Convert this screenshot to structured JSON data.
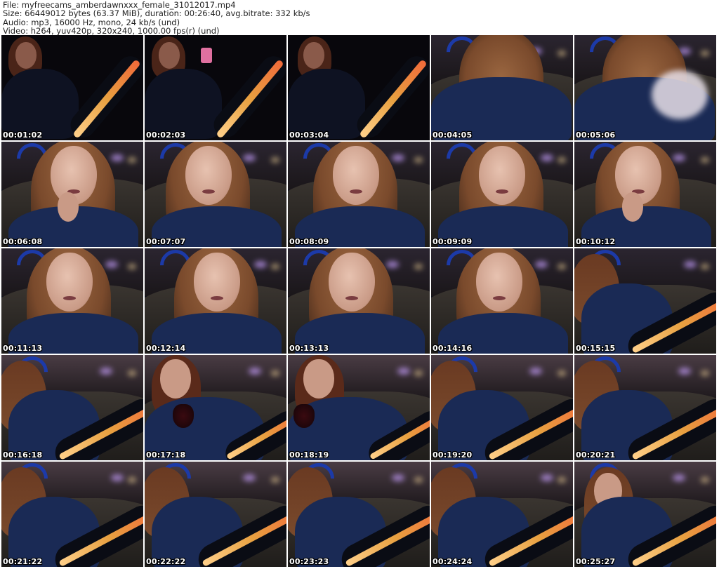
{
  "header": {
    "file": "File: myfreecams_amberdawnxxx_female_31012017.mp4",
    "size": "Size: 66449012 bytes (63.37 MiB), duration: 00:26:40, avg.bitrate: 332 kb/s",
    "audio": "Audio: mp3, 16000 Hz, mono, 24 kb/s (und)",
    "video": "Video: h264, yuv420p, 320x240, 1000.00 fps(r) (und)"
  },
  "thumbnails": [
    {
      "timestamp": "00:01:02",
      "scene": "dark-recline"
    },
    {
      "timestamp": "00:02:03",
      "scene": "dark-phone"
    },
    {
      "timestamp": "00:03:04",
      "scene": "dark-leg"
    },
    {
      "timestamp": "00:04:05",
      "scene": "blur-lean"
    },
    {
      "timestamp": "00:05:06",
      "scene": "hand-blur"
    },
    {
      "timestamp": "00:06:08",
      "scene": "closeup-hand"
    },
    {
      "timestamp": "00:07:07",
      "scene": "closeup"
    },
    {
      "timestamp": "00:08:09",
      "scene": "closeup"
    },
    {
      "timestamp": "00:09:09",
      "scene": "closeup-small"
    },
    {
      "timestamp": "00:10:12",
      "scene": "closeup-hand"
    },
    {
      "timestamp": "00:11:13",
      "scene": "closeup"
    },
    {
      "timestamp": "00:12:14",
      "scene": "closeup"
    },
    {
      "timestamp": "00:13:13",
      "scene": "closeup"
    },
    {
      "timestamp": "00:14:16",
      "scene": "closeup"
    },
    {
      "timestamp": "00:15:15",
      "scene": "lean-leg"
    },
    {
      "timestamp": "00:16:18",
      "scene": "lean-leg"
    },
    {
      "timestamp": "00:17:18",
      "scene": "glass"
    },
    {
      "timestamp": "00:18:19",
      "scene": "glass-sit"
    },
    {
      "timestamp": "00:19:20",
      "scene": "lean-leg"
    },
    {
      "timestamp": "00:20:21",
      "scene": "lean-leg"
    },
    {
      "timestamp": "00:21:22",
      "scene": "lean-leg"
    },
    {
      "timestamp": "00:22:22",
      "scene": "lean-leg"
    },
    {
      "timestamp": "00:23:23",
      "scene": "lean-leg"
    },
    {
      "timestamp": "00:24:24",
      "scene": "lean-leg"
    },
    {
      "timestamp": "00:25:27",
      "scene": "sit-leg"
    }
  ],
  "colors": {
    "background": "#ffffff",
    "text": "#222222",
    "timestamp_text": "#ffffff",
    "sweater": "#1a2a55",
    "hair": "#7a4a2c",
    "skin": "#c99a86",
    "stripe_orange": "#e8a040",
    "sofa": "#2a2826",
    "wall": "#3a3238"
  }
}
